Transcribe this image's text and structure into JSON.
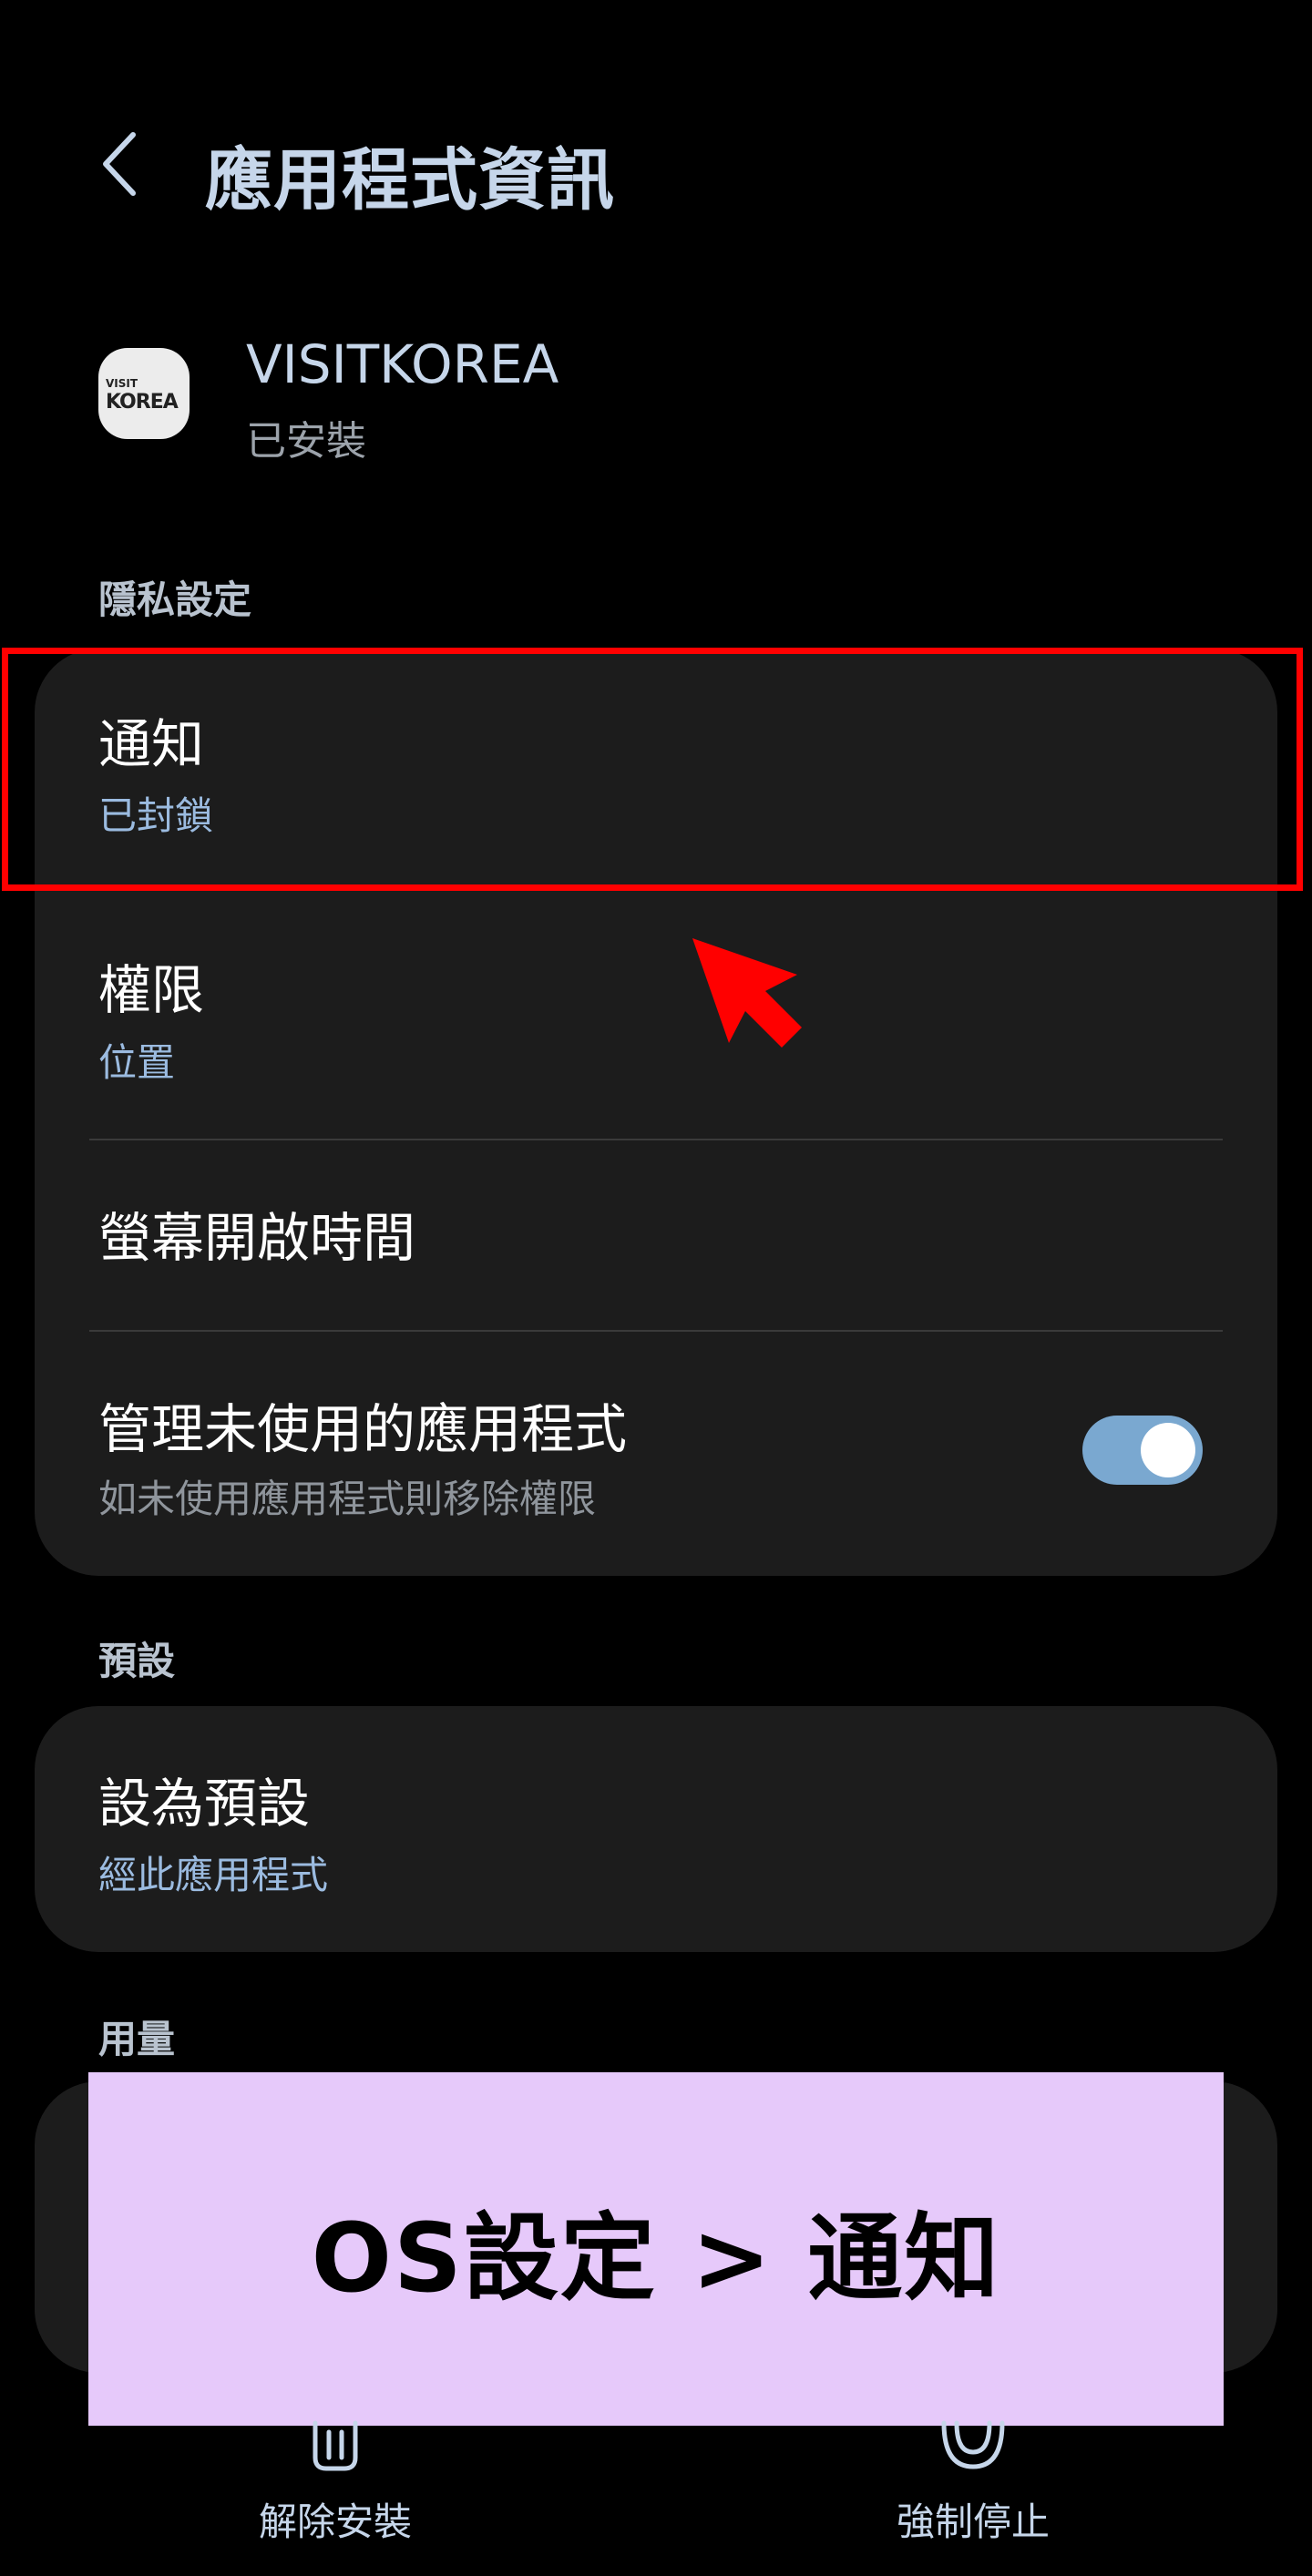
{
  "header": {
    "title": "應用程式資訊",
    "back_icon": "chevron-left-icon"
  },
  "app": {
    "icon_text_line1": "VISIT",
    "icon_text_line2": "KOREA",
    "name": "VISITKOREA",
    "status": "已安裝"
  },
  "privacy": {
    "label": "隱私設定",
    "items": [
      {
        "title": "通知",
        "subtitle": "已封鎖"
      },
      {
        "title": "權限",
        "subtitle": "位置"
      },
      {
        "title": "螢幕開啟時間"
      },
      {
        "title": "管理未使用的應用程式",
        "subtitle": "如未使用應用程式則移除權限",
        "toggle_on": true
      }
    ]
  },
  "defaults": {
    "label": "預設",
    "items": [
      {
        "title": "設為預設",
        "subtitle": "經此應用程式"
      }
    ]
  },
  "usage": {
    "label": "用量"
  },
  "banner": {
    "text": "OS設定 > 通知"
  },
  "bottom_bar": {
    "uninstall_label": "解除安裝",
    "force_stop_label": "強制停止"
  },
  "colors": {
    "background": "#000000",
    "card": "#1c1c1c",
    "accent_blue": "#9bbbe0",
    "toggle_on": "#7aa8d0",
    "highlight": "#ff0000",
    "banner": "#e6c9fa"
  }
}
